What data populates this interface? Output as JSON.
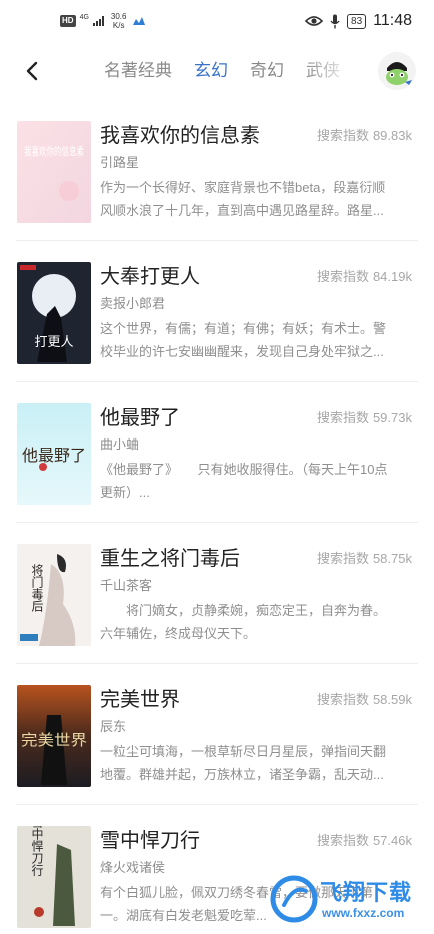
{
  "status_bar": {
    "hd_label": "HD",
    "network_label": "4G",
    "speed_value": "30.6",
    "speed_unit": "K/s",
    "battery": "83",
    "time": "11:48"
  },
  "nav": {
    "back_icon": "chevron-left-icon",
    "tabs": [
      {
        "label": "名著经典",
        "active": false
      },
      {
        "label": "玄幻",
        "active": true
      },
      {
        "label": "奇幻",
        "active": false
      },
      {
        "label": "武侠",
        "active": false
      }
    ]
  },
  "books": [
    {
      "title": "我喜欢你的信息素",
      "author": "引路星",
      "index_label": "搜索指数",
      "index_value": "89.83k",
      "description": "作为一个长得好、家庭背景也不错beta，段嘉衍顺风顺水浪了十几年，直到高中遇见路星辞。路星...",
      "cover_text": "我喜欢你的信息素"
    },
    {
      "title": "大奉打更人",
      "author": "卖报小郎君",
      "index_label": "搜索指数",
      "index_value": "84.19k",
      "description": "这个世界，有儒；有道；有佛；有妖；有术士。警校毕业的许七安幽幽醒来，发现自己身处牢狱之...",
      "cover_text": "打更人"
    },
    {
      "title": "他最野了",
      "author": "曲小蛐",
      "index_label": "搜索指数",
      "index_value": "59.73k",
      "description": "《他最野了》　　只有她收服得住。（每天上午10点更新）...",
      "cover_text": "他最野了"
    },
    {
      "title": "重生之将门毒后",
      "author": "千山茶客",
      "index_label": "搜索指数",
      "index_value": "58.75k",
      "description": "　　将门嫡女，贞静柔婉，痴恋定王，自奔为眷。　　六年辅佐，终成母仪天下。",
      "cover_text": "将门毒后"
    },
    {
      "title": "完美世界",
      "author": "辰东",
      "index_label": "搜索指数",
      "index_value": "58.59k",
      "description": "一粒尘可填海，一根草斩尽日月星辰，弹指间天翻地覆。群雄并起，万族林立，诸圣争霸，乱天动...",
      "cover_text": "完美世界"
    },
    {
      "title": "雪中悍刀行",
      "author": "烽火戏诸侯",
      "index_label": "搜索指数",
      "index_value": "57.46k",
      "description": "有个白狐儿脸，佩双刀绣冬春雷，要做那天下第一。湖底有白发老魁爱吃荤...",
      "cover_text": "雪中悍刀行"
    }
  ],
  "watermark": {
    "brand": "飞翔下载",
    "url": "www.fxxz.com"
  },
  "colors": {
    "accent": "#3a73c9",
    "muted": "#8f8f8f",
    "watermark": "#2e8be6"
  }
}
